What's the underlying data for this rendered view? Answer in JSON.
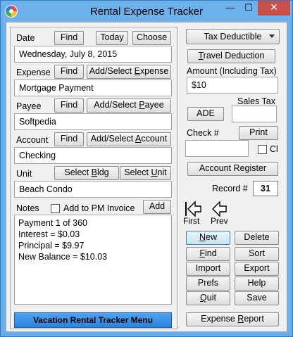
{
  "window": {
    "title": "Rental Expense Tracker",
    "minimize": "—",
    "maximize": "☐",
    "close": "✕"
  },
  "date": {
    "label": "Date",
    "find": "Find",
    "today": "Today",
    "choose": "Choose",
    "value": "Wednesday, July 8, 2015"
  },
  "expense": {
    "label": "Expense",
    "find": "Find",
    "add_select": "Add/Select Expense",
    "value": "Mortgage Payment"
  },
  "payee": {
    "label": "Payee",
    "find": "Find",
    "add_select": "Add/Select Payee",
    "value": "Softpedia"
  },
  "account": {
    "label": "Account",
    "find": "Find",
    "add_select": "Add/Select Account",
    "value": "Checking"
  },
  "unit": {
    "label": "Unit",
    "select_bldg": "Select Bldg",
    "select_unit": "Select Unit",
    "value": "Beach Condo"
  },
  "notes": {
    "label": "Notes",
    "add_to_pm": "Add to PM Invoice",
    "add": "Add",
    "lines": [
      "Payment 1 of 360",
      "Interest = $0.03",
      "Principal = $9.97",
      "New Balance = $10.03"
    ]
  },
  "vacation_menu": "Vacation Rental Tracker Menu",
  "right": {
    "tax_combo": "Tax Deductible",
    "travel": "Travel Deduction",
    "amount_label": "Amount (Including Tax)",
    "amount_value": "$10",
    "sales_tax_label": "Sales Tax",
    "sales_tax_value": "",
    "ade": "ADE",
    "check_label": "Check #",
    "print": "Print",
    "check_value": "",
    "cl_label": "Cl",
    "account_register": "Account Register",
    "record_label": "Record #",
    "record_value": "31",
    "first": "First",
    "prev": "Prev"
  },
  "actions": {
    "new": "New",
    "delete": "Delete",
    "find": "Find",
    "sort": "Sort",
    "import": "Import",
    "export": "Export",
    "prefs": "Prefs",
    "help": "Help",
    "quit": "Quit",
    "save": "Save",
    "expense_report": "Expense Report"
  }
}
